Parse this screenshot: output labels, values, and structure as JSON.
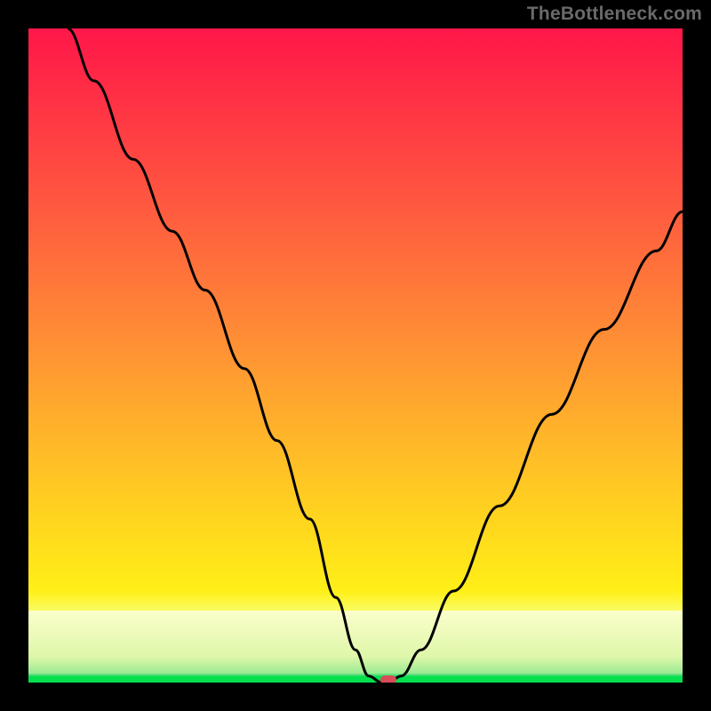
{
  "watermark": "TheBottleneck.com",
  "chart_data": {
    "type": "line",
    "title": "",
    "xlabel": "",
    "ylabel": "",
    "xlim": [
      0,
      100
    ],
    "ylim": [
      0,
      100
    ],
    "grid": false,
    "legend": false,
    "series": [
      {
        "name": "bottleneck-curve",
        "x": [
          6,
          10,
          16,
          22,
          27,
          33,
          38,
          43,
          47,
          50,
          52,
          54,
          55,
          57,
          60,
          65,
          72,
          80,
          88,
          96,
          100
        ],
        "values": [
          100,
          92,
          80,
          69,
          60,
          48,
          37,
          25,
          13,
          5,
          1,
          0,
          0,
          1,
          5,
          14,
          27,
          41,
          54,
          66,
          72
        ]
      }
    ],
    "marker": {
      "x": 55,
      "y": 0
    },
    "background_gradient": [
      "#ff1749",
      "#ff8a36",
      "#ffef17",
      "#dff7aa",
      "#04e04e"
    ]
  }
}
